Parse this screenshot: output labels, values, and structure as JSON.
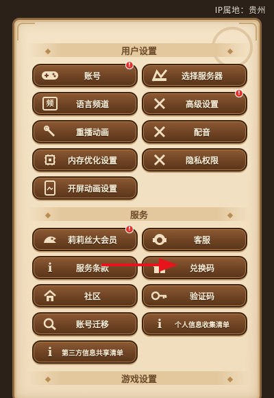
{
  "ip_location": "IP属地：贵州",
  "sections": {
    "user_settings": "用户设置",
    "services": "服务",
    "game_settings": "游戏设置"
  },
  "user_buttons": {
    "account": {
      "label": "账号",
      "badge": "!"
    },
    "select_server": {
      "label": "选择服务器"
    },
    "language_channel": {
      "label": "语言频道"
    },
    "advanced_settings": {
      "label": "高级设置",
      "badge": "!"
    },
    "replay_animation": {
      "label": "重播动画"
    },
    "dubbing": {
      "label": "配音"
    },
    "memory_optimization": {
      "label": "内存优化设置"
    },
    "privacy_permissions": {
      "label": "隐私权限"
    },
    "splash_animation": {
      "label": "开屏动画设置"
    }
  },
  "service_buttons": {
    "vip": {
      "label": "莉莉丝大会员",
      "badge": "!"
    },
    "customer_service": {
      "label": "客服"
    },
    "terms": {
      "label": "服务条款"
    },
    "redeem_code": {
      "label": "兑换码"
    },
    "community": {
      "label": "社区"
    },
    "verification_code": {
      "label": "验证码"
    },
    "account_migration": {
      "label": "账号迁移"
    },
    "personal_info_list": {
      "label": "个人信息收集清单"
    },
    "third_party_list": {
      "label": "第三方信息共享清单"
    }
  },
  "icons": {
    "language_glyph": "频",
    "info_glyph": "i"
  },
  "colors": {
    "panel_bg": "#f4e3c6",
    "button_bg": "#6e4324",
    "badge": "#e0332b",
    "annotation_arrow": "#e8141b"
  }
}
